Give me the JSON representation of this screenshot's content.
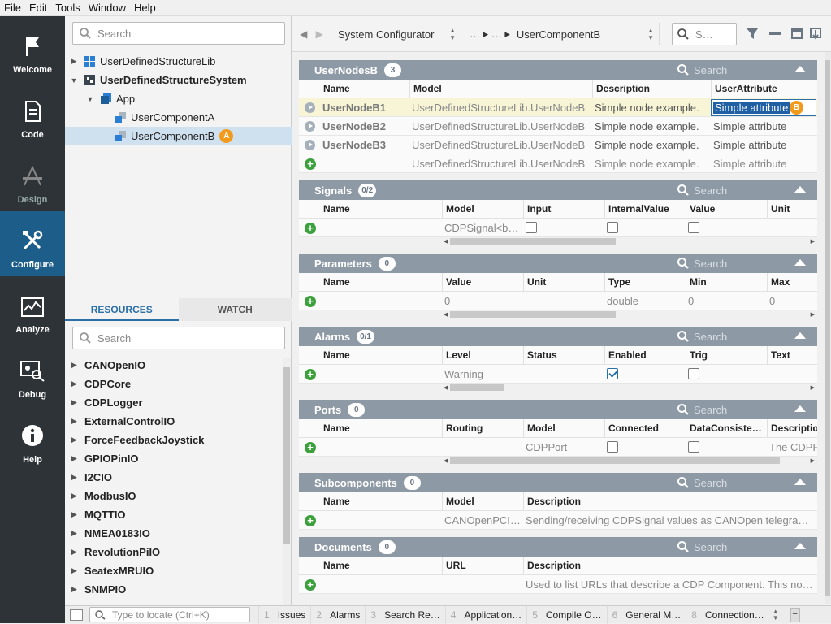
{
  "menu": [
    "File",
    "Edit",
    "Tools",
    "Window",
    "Help"
  ],
  "nav": [
    {
      "label": "Welcome",
      "icon": "flag-icon",
      "active": false
    },
    {
      "label": "Code",
      "icon": "document-icon",
      "active": false
    },
    {
      "label": "Design",
      "icon": "design-icon",
      "active": false
    },
    {
      "label": "Configure",
      "icon": "tools-icon",
      "active": true
    },
    {
      "label": "Analyze",
      "icon": "chart-icon",
      "active": false
    },
    {
      "label": "Debug",
      "icon": "debug-icon",
      "active": false
    },
    {
      "label": "Help",
      "icon": "info-icon",
      "active": false
    }
  ],
  "tree": {
    "search_placeholder": "Search",
    "items": [
      {
        "label": "UserDefinedStructureLib"
      },
      {
        "label": "UserDefinedStructureSystem"
      },
      {
        "label": "App"
      },
      {
        "label": "UserComponentA"
      },
      {
        "label": "UserComponentB",
        "badge": "A"
      }
    ]
  },
  "resources": {
    "tabs": [
      "RESOURCES",
      "WATCH"
    ],
    "search_placeholder": "Search",
    "items": [
      "CANOpenIO",
      "CDPCore",
      "CDPLogger",
      "ExternalControlIO",
      "ForceFeedbackJoystick",
      "GPIOPinIO",
      "I2CIO",
      "ModbusIO",
      "MQTTIO",
      "NMEA0183IO",
      "RevolutionPiIO",
      "SeatexMRUIO",
      "SNMPIO"
    ]
  },
  "topbar": {
    "selector": "System Configurator",
    "breadcrumb_ellipsis": "… ▸ … ▸",
    "breadcrumb_current": "UserComponentB",
    "search_placeholder": "S…"
  },
  "panel_search": "Search",
  "usernodes": {
    "title": "UserNodesB",
    "count": "3",
    "columns": [
      "Name",
      "Model",
      "Description",
      "UserAttribute"
    ],
    "rows": [
      {
        "name": "UserNodeB1",
        "model": "UserDefinedStructureLib.UserNodeB",
        "desc": "Simple node example.",
        "attr": "Simple attribute",
        "badge": "B"
      },
      {
        "name": "UserNodeB2",
        "model": "UserDefinedStructureLib.UserNodeB",
        "desc": "Simple node example.",
        "attr": "Simple attribute"
      },
      {
        "name": "UserNodeB3",
        "model": "UserDefinedStructureLib.UserNodeB",
        "desc": "Simple node example.",
        "attr": "Simple attribute"
      },
      {
        "name": "",
        "model": "UserDefinedStructureLib.UserNodeB",
        "desc": "Simple node example.",
        "attr": "Simple attribute"
      }
    ]
  },
  "signals": {
    "title": "Signals",
    "count": "0/2",
    "columns": [
      "Name",
      "Model",
      "Input",
      "InternalValue",
      "Value",
      "Unit"
    ],
    "row": {
      "model": "CDPSignal<b…"
    }
  },
  "parameters": {
    "title": "Parameters",
    "count": "0",
    "columns": [
      "Name",
      "Value",
      "Unit",
      "Type",
      "Min",
      "Max"
    ],
    "row": {
      "value": "0",
      "type": "double",
      "min": "0",
      "max": "0"
    }
  },
  "alarms": {
    "title": "Alarms",
    "count": "0/1",
    "columns": [
      "Name",
      "Level",
      "Status",
      "Enabled",
      "Trig",
      "Text"
    ],
    "row": {
      "level": "Warning",
      "enabled": true,
      "trig": false
    }
  },
  "ports": {
    "title": "Ports",
    "count": "0",
    "columns": [
      "Name",
      "Routing",
      "Model",
      "Connected",
      "DataConsiste…",
      "Descriptio"
    ],
    "row": {
      "model": "CDPPort",
      "desc": "The CDPP"
    }
  },
  "subcomponents": {
    "title": "Subcomponents",
    "count": "0",
    "columns": [
      "Name",
      "Model",
      "Description"
    ],
    "row": {
      "model": "CANOpenPCI…",
      "desc": "Sending/receiving CDPSignal values as CANOpen telegra…"
    }
  },
  "documents": {
    "title": "Documents",
    "count": "0",
    "columns": [
      "Name",
      "URL",
      "Description"
    ],
    "row": {
      "desc": "Used to list URLs that describe a CDP Component. This no…"
    }
  },
  "statusbar": {
    "locate_placeholder": "Type to locate (Ctrl+K)",
    "tabs": [
      {
        "n": "1",
        "label": "Issues"
      },
      {
        "n": "2",
        "label": "Alarms"
      },
      {
        "n": "3",
        "label": "Search Re…"
      },
      {
        "n": "4",
        "label": "Application…"
      },
      {
        "n": "5",
        "label": "Compile O…"
      },
      {
        "n": "6",
        "label": "General M…"
      },
      {
        "n": "8",
        "label": "Connection…"
      }
    ]
  }
}
